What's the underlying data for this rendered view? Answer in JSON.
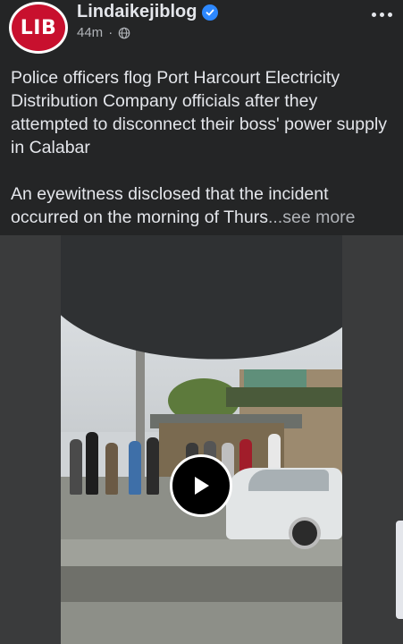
{
  "post": {
    "avatar_text": "LIB",
    "page_name": "Lindaikejiblog",
    "time": "44m",
    "dot": "·",
    "paragraph1": "Police officers flog Port Harcourt Electricity Distribution Company officials after they attempted to disconnect their boss' power supply in Calabar",
    "paragraph2": "An eyewitness disclosed that the incident occurred on the morning of Thurs",
    "ellipsis": "...",
    "see_more": "see more"
  },
  "icons": {
    "verified": "verified-badge-icon",
    "audience": "globe-icon",
    "more": "more-options-icon",
    "play": "play-icon"
  },
  "colors": {
    "background": "#242526",
    "text": "#e4e6eb",
    "secondary_text": "#b0b3b8",
    "brand_red": "#c8102e",
    "verified_blue": "#2d88ff"
  }
}
